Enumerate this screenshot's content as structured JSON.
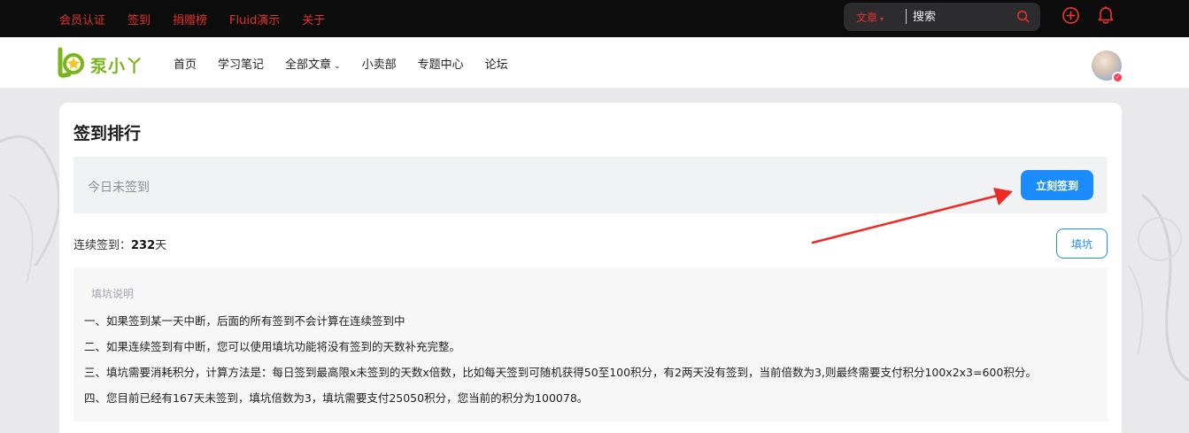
{
  "topbar": {
    "links": [
      {
        "label": "会员认证",
        "active": false
      },
      {
        "label": "签到",
        "active": true
      },
      {
        "label": "捐赠榜",
        "active": false
      },
      {
        "label": "Fluid演示",
        "active": false
      },
      {
        "label": "关于",
        "active": false
      }
    ],
    "search": {
      "type_label": "文章",
      "placeholder": "搜索"
    },
    "icons": [
      "plus-circle-icon",
      "bell-icon",
      "search-icon"
    ],
    "accent_color": "#e5322b"
  },
  "navbar": {
    "logo_text": "泵小丫",
    "items": [
      {
        "label": "首页"
      },
      {
        "label": "学习笔记"
      },
      {
        "label": "全部文章",
        "has_dropdown": true
      },
      {
        "label": "小卖部"
      },
      {
        "label": "专题中心"
      },
      {
        "label": "论坛"
      }
    ]
  },
  "checkin": {
    "title": "签到排行",
    "status": "今日未签到",
    "button_label": "立刻签到",
    "streak_label": "连续签到：",
    "streak_value": "232",
    "streak_unit": "天",
    "fill_button_label": "填坑",
    "explain_title": "填坑说明",
    "explain_lines": [
      "一、如果签到某一天中断，后面的所有签到不会计算在连续签到中",
      "二、如果连续签到有中断，您可以使用填坑功能将没有签到的天数补充完整。",
      "三、填坑需要消耗积分，计算方法是：每日签到最高限x未签到的天数x倍数，比如每天签到可随机获得50至100积分，有2两天没有签到，当前倍数为3,则最终需要支付积分100x2x3=600积分。",
      "四、您目前已经有167天未签到，填坑倍数为3，填坑需要支付25050积分，您当前的积分为100078。"
    ],
    "primary_color": "#1a8cff"
  }
}
